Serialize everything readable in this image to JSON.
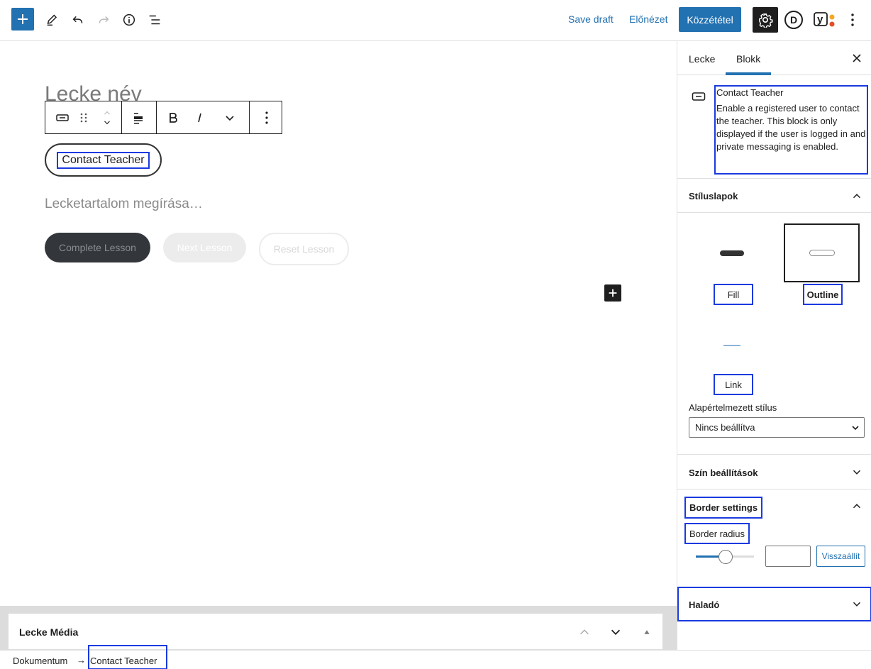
{
  "topbar": {
    "save_draft": "Save draft",
    "preview": "Előnézet",
    "publish": "Közzététel",
    "avatar_letter": "D",
    "yoast_letter": "y"
  },
  "editor": {
    "lesson_title": "Lecke név",
    "contact_button": "Contact Teacher",
    "content_placeholder": "Lecketartalom megírása…",
    "complete_lesson": "Complete Lesson",
    "next_lesson": "Next Lesson",
    "reset_lesson": "Reset Lesson"
  },
  "metabox": {
    "title": "Lecke Média"
  },
  "breadcrumb": {
    "root": "Dokumentum",
    "separator": "→",
    "current": "Contact Teacher"
  },
  "sidebar": {
    "tabs": [
      "Lecke",
      "Blokk"
    ],
    "active_tab": "Blokk",
    "block": {
      "title": "Contact Teacher",
      "description": "Enable a registered user to contact the teacher. This block is only displayed if the user is logged in and private messaging is enabled."
    },
    "styles_panel": {
      "title": "Stíluslapok",
      "styles": [
        "Fill",
        "Outline",
        "Link"
      ],
      "selected": "Outline",
      "default_label": "Alapértelmezett stílus",
      "default_value": "Nincs beállítva"
    },
    "color_panel": {
      "title": "Szín beállítások"
    },
    "border_panel": {
      "title": "Border settings",
      "radius_label": "Border radius",
      "radius_value": "",
      "slider_fraction": 0.5,
      "reset_label": "Visszaállít"
    },
    "advanced_panel": {
      "title": "Haladó"
    }
  },
  "colors": {
    "accent": "#2271b1",
    "highlight_box": "#1a3ae0",
    "dark": "#1e1e1e"
  }
}
